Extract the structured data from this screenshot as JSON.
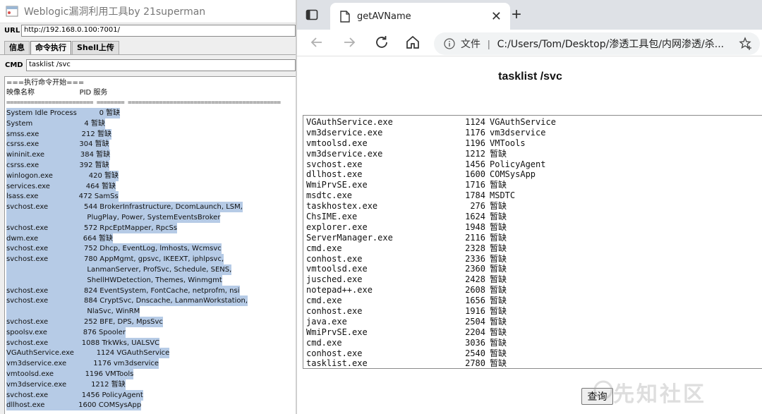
{
  "tool": {
    "window_title": "Weblogic漏洞利用工具by 21superman",
    "url_label": "URL",
    "url_value": "http://192.168.0.100:7001/",
    "tabs": [
      {
        "label": "信息"
      },
      {
        "label": "命令执行"
      },
      {
        "label": "Shell上传"
      }
    ],
    "cmd_label": "CMD",
    "cmd_value": "tasklist /svc",
    "output_header": [
      "===执行命令开始===",
      "映像名称                    PID 服务",
      "========================= ======== ============================================"
    ],
    "output_lines": [
      "System Idle Process          0 暂缺",
      "System                       4 暂缺",
      "smss.exe                   212 暂缺",
      "csrss.exe                  304 暂缺",
      "wininit.exe                384 暂缺",
      "csrss.exe                  392 暂缺",
      "winlogon.exe                420 暂缺",
      "services.exe                464 暂缺",
      "lsass.exe                  472 SamSs",
      "svchost.exe                544 BrokerInfrastructure, DcomLaunch, LSM,",
      "                                    PlugPlay, Power, SystemEventsBroker",
      "svchost.exe                572 RpcEptMapper, RpcSs",
      "dwm.exe                    664 暂缺",
      "svchost.exe                752 Dhcp, EventLog, lmhosts, Wcmsvc",
      "svchost.exe                780 AppMgmt, gpsvc, IKEEXT, iphlpsvc,",
      "                                    LanmanServer, ProfSvc, Schedule, SENS,",
      "                                    ShellHWDetection, Themes, Winmgmt",
      "svchost.exe                824 EventSystem, FontCache, netprofm, nsi",
      "svchost.exe                884 CryptSvc, Dnscache, LanmanWorkstation,",
      "                                    NlaSvc, WinRM",
      "svchost.exe                252 BFE, DPS, MpsSvc",
      "spoolsv.exe                876 Spooler",
      "svchost.exe               1088 TrkWks, UALSVC",
      "VGAuthService.exe          1124 VGAuthService",
      "vm3dservice.exe            1176 vm3dservice",
      "vmtoolsd.exe              1196 VMTools",
      "vm3dservice.exe           1212 暂缺",
      "svchost.exe               1456 PolicyAgent",
      "dllhost.exe               1600 COMSysApp"
    ]
  },
  "browser": {
    "tab_title": "getAVName",
    "site_label": "文件",
    "address": "C:/Users/Tom/Desktop/渗透工具包/内网渗透/杀...",
    "page_heading": "tasklist /svc",
    "results": [
      {
        "name": "VGAuthService.exe",
        "pid": "1124",
        "svc": "VGAuthService"
      },
      {
        "name": "vm3dservice.exe",
        "pid": "1176",
        "svc": "vm3dservice"
      },
      {
        "name": "vmtoolsd.exe",
        "pid": "1196",
        "svc": "VMTools"
      },
      {
        "name": "vm3dservice.exe",
        "pid": "1212",
        "svc": "暂缺"
      },
      {
        "name": "svchost.exe",
        "pid": "1456",
        "svc": "PolicyAgent"
      },
      {
        "name": "dllhost.exe",
        "pid": "1600",
        "svc": "COMSysApp"
      },
      {
        "name": "WmiPrvSE.exe",
        "pid": "1716",
        "svc": "暂缺"
      },
      {
        "name": "msdtc.exe",
        "pid": "1784",
        "svc": "MSDTC"
      },
      {
        "name": "taskhostex.exe",
        "pid": "276",
        "svc": "暂缺"
      },
      {
        "name": "ChsIME.exe",
        "pid": "1624",
        "svc": "暂缺"
      },
      {
        "name": "explorer.exe",
        "pid": "1948",
        "svc": "暂缺"
      },
      {
        "name": "ServerManager.exe",
        "pid": "2116",
        "svc": "暂缺"
      },
      {
        "name": "cmd.exe",
        "pid": "2328",
        "svc": "暂缺"
      },
      {
        "name": "conhost.exe",
        "pid": "2336",
        "svc": "暂缺"
      },
      {
        "name": "vmtoolsd.exe",
        "pid": "2360",
        "svc": "暂缺"
      },
      {
        "name": "jusched.exe",
        "pid": "2428",
        "svc": "暂缺"
      },
      {
        "name": "notepad++.exe",
        "pid": "2608",
        "svc": "暂缺"
      },
      {
        "name": "cmd.exe",
        "pid": "1656",
        "svc": "暂缺"
      },
      {
        "name": "conhost.exe",
        "pid": "1916",
        "svc": "暂缺"
      },
      {
        "name": "java.exe",
        "pid": "2504",
        "svc": "暂缺"
      },
      {
        "name": "WmiPrvSE.exe",
        "pid": "2204",
        "svc": "暂缺"
      },
      {
        "name": "cmd.exe",
        "pid": "3036",
        "svc": "暂缺"
      },
      {
        "name": "conhost.exe",
        "pid": "2540",
        "svc": "暂缺"
      },
      {
        "name": "tasklist.exe",
        "pid": "2780",
        "svc": "暂缺"
      }
    ],
    "query_button": "查询",
    "watermark": "先知社区"
  },
  "colors": {
    "selection": "#b6cbe6",
    "tabstrip": "#dee1e6",
    "address_bar": "#f1f3f4"
  }
}
